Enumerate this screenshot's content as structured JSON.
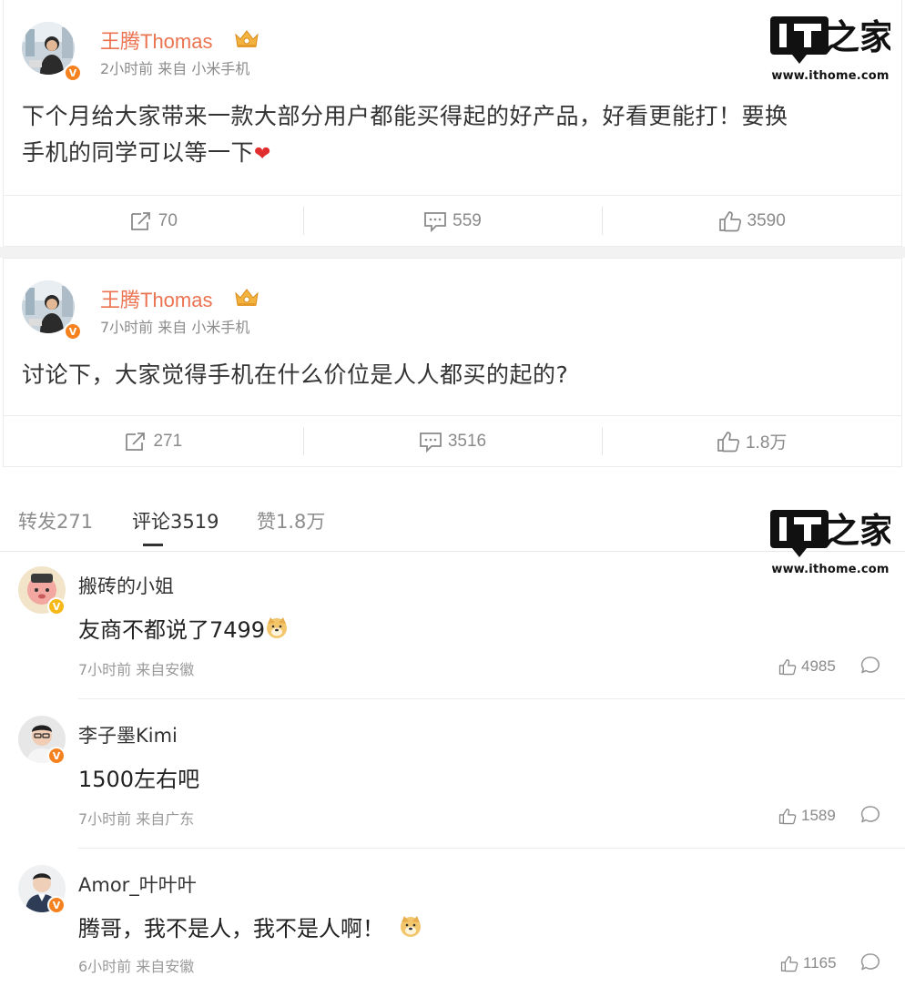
{
  "watermark": {
    "url": "www.ithome.com",
    "mark_text": "IT之家"
  },
  "posts": [
    {
      "username": "王腾Thomas",
      "meta": "2小时前 来自 小米手机",
      "content_line1": "下个月给大家带来一款大部分用户都能买得起的好产品，好看更能打！要换",
      "content_line2": "手机的同学可以等一下",
      "emoji": "heart-emoji",
      "reposts": "70",
      "comments": "559",
      "likes": "3590"
    },
    {
      "username": "王腾Thomas",
      "meta": "7小时前 来自 小米手机",
      "content_line1": "讨论下，大家觉得手机在什么价位是人人都买的起的?",
      "reposts": "271",
      "comments": "3516",
      "likes": "1.8万"
    }
  ],
  "tabs": [
    {
      "label": "转发271",
      "active": false
    },
    {
      "label": "评论3519",
      "active": true
    },
    {
      "label": "赞1.8万",
      "active": false
    }
  ],
  "comments": [
    {
      "username": "搬砖的小姐",
      "text": "友商不都说了7499",
      "emoji": "doge-emoji",
      "meta": "7小时前 来自安徽",
      "likes": "4985"
    },
    {
      "username": "李子墨Kimi",
      "text": "1500左右吧",
      "meta": "7小时前 来自广东",
      "likes": "1589"
    },
    {
      "username": "Amor_叶叶叶",
      "text": "腾哥，我不是人，我不是人啊！",
      "emoji": "doge-emoji",
      "meta": "6小时前 来自安徽",
      "likes": "1165"
    }
  ],
  "colors": {
    "username_accent": "#eb7350",
    "verified_badge": "#f5821f",
    "verified_badge_yellow": "#f7b81a",
    "muted_text": "#8a8a8a",
    "heart": "#e02e2e"
  }
}
